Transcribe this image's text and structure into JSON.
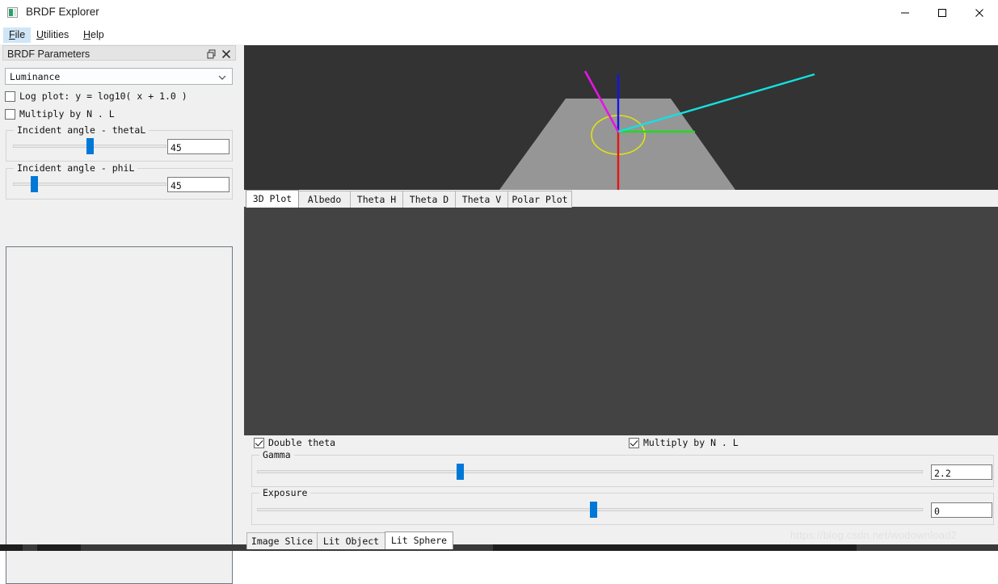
{
  "window": {
    "title": "BRDF Explorer",
    "icon": "app-icon",
    "controls": {
      "minimize": "—",
      "maximize": "□",
      "close": "✕"
    }
  },
  "menubar": {
    "items": [
      {
        "label": "File",
        "mnemonic": "F",
        "active": true
      },
      {
        "label": "Utilities",
        "mnemonic": "U",
        "active": false
      },
      {
        "label": "Help",
        "mnemonic": "H",
        "active": false
      }
    ]
  },
  "dock": {
    "title": "BRDF Parameters",
    "float_icon": "undock-icon",
    "close_icon": "close-icon",
    "channel_select": {
      "value": "Luminance",
      "arrow_icon": "chevron-down-icon"
    },
    "checkboxes": [
      {
        "label": "Log plot:  y = log10( x + 1.0 )",
        "checked": false
      },
      {
        "label": "Multiply by N . L",
        "checked": false
      }
    ],
    "sliders": [
      {
        "title": "Incident angle - thetaL",
        "value": "45",
        "percent": 50
      },
      {
        "title": "Incident angle - phiL",
        "value": "45",
        "percent": 12
      }
    ]
  },
  "viewport": {
    "top_background": "#333333",
    "bottom_background": "#434343",
    "ground_color": "#969696",
    "axes": [
      {
        "name": "normal-axis",
        "color": "#1414e6"
      },
      {
        "name": "incident-light-axis",
        "color": "#e614e6"
      },
      {
        "name": "view-axis",
        "color": "#14e1e1"
      },
      {
        "name": "tangent-axis",
        "color": "#14e114"
      },
      {
        "name": "down-axis",
        "color": "#e61414"
      },
      {
        "name": "azimuth-ring",
        "color": "#e1e114"
      }
    ]
  },
  "plot_tabs": {
    "items": [
      {
        "label": "3D Plot",
        "active": true
      },
      {
        "label": "Albedo",
        "active": false
      },
      {
        "label": "Theta H",
        "active": false
      },
      {
        "label": "Theta D",
        "active": false
      },
      {
        "label": "Theta V",
        "active": false
      },
      {
        "label": "Polar Plot",
        "active": false
      }
    ]
  },
  "render_controls": {
    "checkboxes": [
      {
        "label": "Double theta",
        "checked": true
      },
      {
        "label": "Multiply by N . L",
        "checked": true
      }
    ],
    "sliders": [
      {
        "title": "Gamma",
        "value": "2.2",
        "percent": 30
      },
      {
        "title": "Exposure",
        "value": "0",
        "percent": 50
      }
    ]
  },
  "render_tabs": {
    "items": [
      {
        "label": "Image Slice",
        "active": false
      },
      {
        "label": "Lit Object",
        "active": false
      },
      {
        "label": "Lit Sphere",
        "active": true
      }
    ]
  },
  "watermark": {
    "text": "https://blog.csdn.net/wodownload2"
  }
}
